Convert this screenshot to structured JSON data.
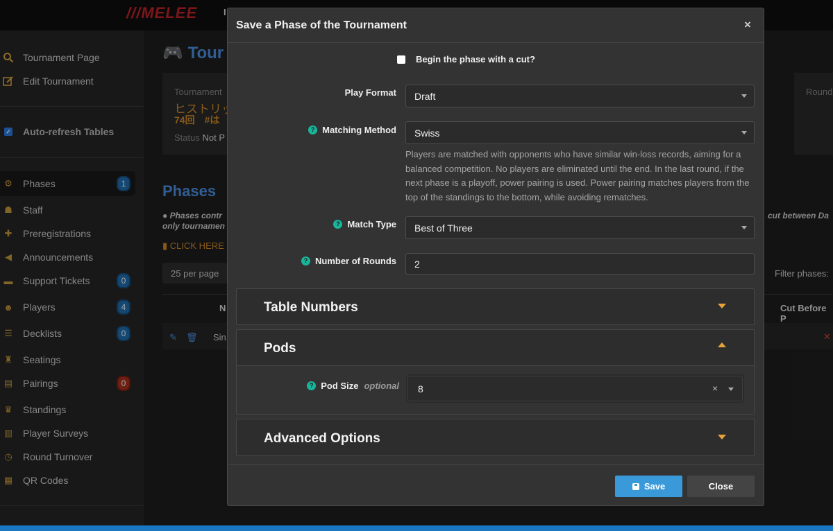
{
  "app": {
    "logo": "///MELEE",
    "topbar_fragment": "I"
  },
  "sidebar": {
    "top_links": [
      {
        "label": "Tournament Page",
        "icon": "search-icon"
      },
      {
        "label": "Edit Tournament",
        "icon": "edit-icon"
      }
    ],
    "auto_refresh_label": "Auto-refresh Tables",
    "nav": [
      {
        "label": "Phases",
        "icon": "phases-icon",
        "badge": "1",
        "active": true
      },
      {
        "label": "Staff",
        "icon": "staff-icon"
      },
      {
        "label": "Preregistrations",
        "icon": "add-user-icon"
      },
      {
        "label": "Announcements",
        "icon": "megaphone-icon"
      },
      {
        "label": "Support Tickets",
        "icon": "ticket-icon",
        "badge": "0"
      },
      {
        "label": "Players",
        "icon": "users-icon",
        "badge": "4"
      },
      {
        "label": "Decklists",
        "icon": "list-icon",
        "badge": "0"
      },
      {
        "label": "Seatings",
        "icon": "chair-icon"
      },
      {
        "label": "Pairings",
        "icon": "clipboard-icon",
        "badge": "0",
        "badge_color": "#a8321f"
      },
      {
        "label": "Standings",
        "icon": "trophy-icon"
      },
      {
        "label": "Player Surveys",
        "icon": "chart-icon"
      },
      {
        "label": "Round Turnover",
        "icon": "stopwatch-icon"
      },
      {
        "label": "QR Codes",
        "icon": "qr-icon"
      }
    ]
  },
  "background": {
    "page_title": "Tour",
    "card_label": "Tournament",
    "card_jp_1": "ヒストリッ",
    "card_jp_2": "74回　#は",
    "card_status_label": "Status",
    "card_status_value": "Not P",
    "right_card_label": "Round",
    "phases_heading": "Phases",
    "phases_note_1": "Phases contr",
    "phases_note_2": "only tournamen",
    "phases_note_right": "cut between Da",
    "click_here": "CLICK HERE",
    "per_page": "25 per page",
    "filter_phases": "Filter phases:",
    "col_name": "N",
    "col_cut_before": "Cut Before P",
    "row_fragment": "Sin"
  },
  "modal": {
    "title": "Save a Phase of the Tournament",
    "cut_checkbox_label": "Begin the phase with a cut?",
    "play_format_label": "Play Format",
    "play_format_value": "Draft",
    "matching_method_label": "Matching Method",
    "matching_method_value": "Swiss",
    "matching_description": "Players are matched with opponents who have similar win-loss records, aiming for a balanced competition. No players are eliminated until the end. In the last round, if the next phase is a playoff, power pairing is used. Power pairing matches players from the top of the standings to the bottom, while avoiding rematches.",
    "match_type_label": "Match Type",
    "match_type_value": "Best of Three",
    "rounds_label": "Number of Rounds",
    "rounds_value": "2",
    "sections": {
      "table_numbers": "Table Numbers",
      "pods": "Pods",
      "advanced": "Advanced Options"
    },
    "pod_size_label": "Pod Size",
    "pod_size_optional": "optional",
    "pod_size_value": "8",
    "save_label": "Save",
    "close_label": "Close"
  },
  "colors": {
    "accent_blue": "#3a9ad9",
    "brand_red": "#c0232a",
    "help_green": "#18b59a",
    "section_arrow": "#e8a23a"
  }
}
